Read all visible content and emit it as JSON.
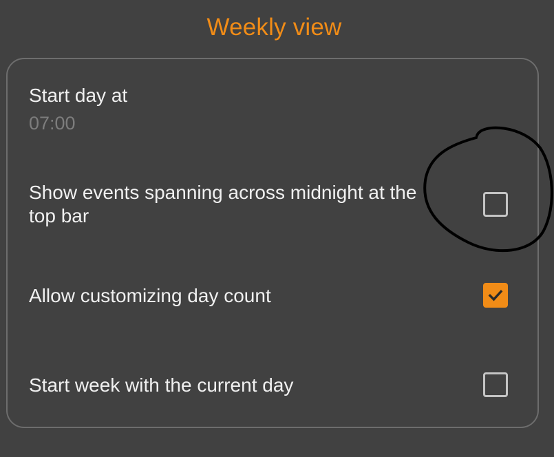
{
  "section": {
    "title": "Weekly view"
  },
  "settings": {
    "start_day": {
      "label": "Start day at",
      "value": "07:00"
    },
    "span_midnight": {
      "label_line1": "Show events spanning across midnight at the",
      "label_line2": "top bar",
      "checked": false
    },
    "custom_day_count": {
      "label": "Allow customizing day count",
      "checked": true
    },
    "start_week_current": {
      "label": "Start week with the current day",
      "checked": false
    }
  },
  "colors": {
    "background": "#414141",
    "accent": "#f18c17",
    "text": "#f0f0f0",
    "subtext": "#7d7d7d",
    "card_border": "#6d6d6d",
    "annotation_ink": "#000000"
  }
}
